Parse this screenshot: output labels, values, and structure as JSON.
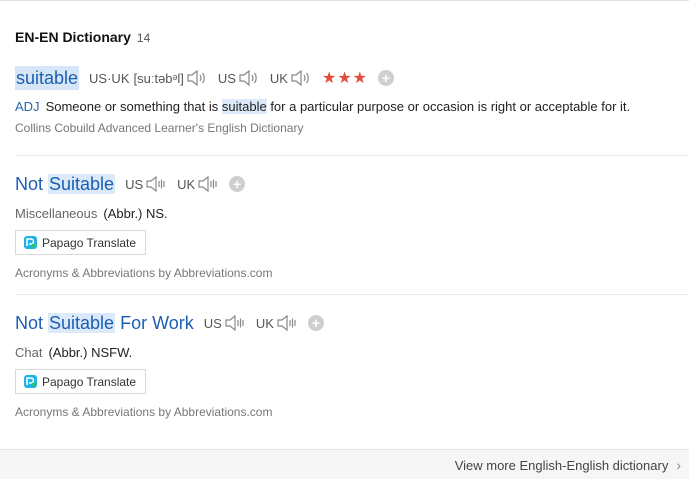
{
  "header": {
    "title": "EN-EN Dictionary",
    "count": "14"
  },
  "entries": [
    {
      "word": "suitable",
      "us_uk_label": "US·UK",
      "phonetic": "[suːtəbᵊl]",
      "us_label": "US",
      "uk_label": "UK",
      "stars": "★★★",
      "pos": "ADJ",
      "def_pre": "Someone or something that is ",
      "def_hl": "suitable",
      "def_post": " for a particular purpose or occasion is right or acceptable for it.",
      "source": "Collins Cobuild Advanced Learner's English Dictionary"
    },
    {
      "word_a": "Not ",
      "word_hl": "Suitable",
      "word_b": "",
      "us_label": "US",
      "uk_label": "UK",
      "category": "Miscellaneous",
      "abbr": "(Abbr.) NS.",
      "translate_label": "Papago Translate",
      "source": "Acronyms & Abbreviations by Abbreviations.com"
    },
    {
      "word_a": "Not ",
      "word_hl": "Suitable",
      "word_b": " For Work",
      "us_label": "US",
      "uk_label": "UK",
      "category": "Chat",
      "abbr": "(Abbr.) NSFW.",
      "translate_label": "Papago Translate",
      "source": "Acronyms & Abbreviations by Abbreviations.com"
    }
  ],
  "footer": {
    "more_label": "View more English-English dictionary"
  },
  "icons": {
    "speaker": "speaker-icon",
    "add": "plus-circle-icon",
    "papago": "papago-logo-icon",
    "chevron": "chevron-right-icon"
  },
  "colors": {
    "link": "#1a5fb4",
    "highlight": "#dbe9f8",
    "stars": "#e24d3c"
  }
}
